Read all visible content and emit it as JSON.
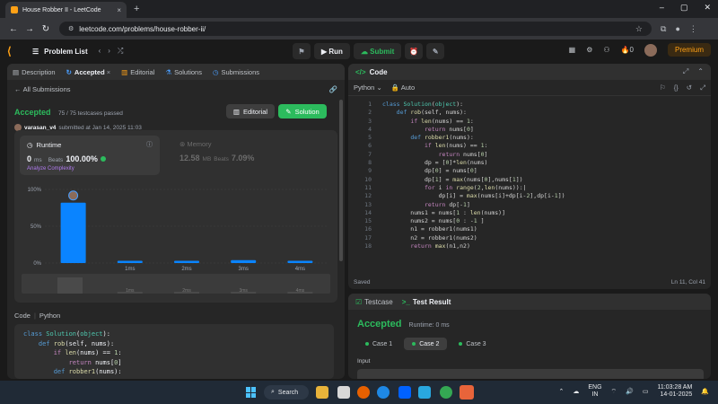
{
  "browser": {
    "tab_title": "House Robber II - LeetCode",
    "tab_close": "×",
    "new_tab": "+",
    "url": "leetcode.com/problems/house-robber-ii/",
    "window_controls": [
      "–",
      "▢",
      "✕"
    ]
  },
  "nav": {
    "logo": "⟨",
    "problem_list": "Problem List",
    "run": "Run",
    "submit": "Submit",
    "streak_count": "0",
    "premium": "Premium"
  },
  "left": {
    "tabs": [
      {
        "label": "Description"
      },
      {
        "label": "Accepted"
      },
      {
        "label": "Editorial"
      },
      {
        "label": "Solutions"
      },
      {
        "label": "Submissions"
      }
    ],
    "accepted_tab_close": "×",
    "all_submissions": "All Submissions",
    "status": "Accepted",
    "testcases": "75 / 75 testcases passed",
    "user": "varasan_v4",
    "submitted": "submitted at Jan 14, 2025 11:03",
    "editorial_btn": "Editorial",
    "solution_btn": "Solution",
    "runtime": {
      "label": "Runtime",
      "value": "0",
      "unit": "ms",
      "beats_label": "Beats",
      "beats": "100.00%",
      "analyze": "Analyze Complexity"
    },
    "memory": {
      "label": "Memory",
      "value": "12.58",
      "unit": "MB",
      "beats_label": "Beats",
      "beats": "7.09%"
    },
    "code_header": {
      "title": "Code",
      "lang": "Python"
    },
    "code_preview": [
      "class Solution(object):",
      "    def rob(self, nums):",
      "        if len(nums) == 1:",
      "            return nums[0]",
      "        def robber1(nums):"
    ]
  },
  "chart_data": {
    "type": "bar",
    "y_ticks": [
      "100%",
      "50%",
      "0%"
    ],
    "ylim": [
      0,
      100
    ],
    "categories": [
      "0ms",
      "1ms",
      "2ms",
      "3ms",
      "4ms"
    ],
    "x_labels_shown": [
      "",
      "1ms",
      "2ms",
      "3ms",
      "4ms"
    ],
    "values": [
      82,
      3,
      3,
      4,
      3
    ],
    "highlight_index": 0,
    "colors": {
      "bar": "#0a84ff",
      "minimap": "#4a4a4a"
    }
  },
  "code": {
    "title": "Code",
    "lang": "Python",
    "auto": "Auto",
    "saved": "Saved",
    "cursor": "Ln 11, Col 41",
    "line_numbers": [
      "1",
      "2",
      "3",
      "4",
      "5",
      "6",
      "7",
      "8",
      "9",
      "10",
      "11",
      "12",
      "13",
      "14",
      "15",
      "16",
      "17",
      "18"
    ]
  },
  "test": {
    "tab_testcase": "Testcase",
    "tab_result": "Test Result",
    "status": "Accepted",
    "runtime": "Runtime: 0 ms",
    "cases": [
      "Case 1",
      "Case 2",
      "Case 3"
    ],
    "input_label": "Input"
  },
  "taskbar": {
    "search": "Search",
    "lang_top": "ENG",
    "lang_bottom": "IN",
    "time": "11:03:28 AM",
    "date": "14-01-2025"
  },
  "colors": {
    "accent_green": "#2cbb5d",
    "brand_orange": "#ffa116",
    "bar_blue": "#0a84ff"
  }
}
